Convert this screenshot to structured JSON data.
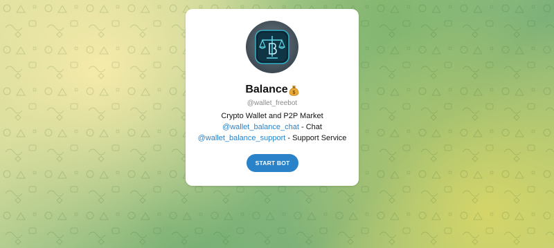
{
  "bot": {
    "name": "Balance",
    "name_emoji_icon": "money-bag-icon",
    "username": "@wallet_freebot",
    "description": {
      "line1": "Crypto Wallet and P2P Market",
      "line2_link": "@wallet_balance_chat",
      "line2_text": " - Chat",
      "line3_link": "@wallet_balance_support",
      "line3_text": " - Support Service"
    },
    "start_button_label": "START BOT",
    "avatar_icon": "scales-logo-icon"
  },
  "colors": {
    "accent": "#2a82c9",
    "muted_text": "#8a8a8a",
    "card_bg": "#ffffff"
  }
}
